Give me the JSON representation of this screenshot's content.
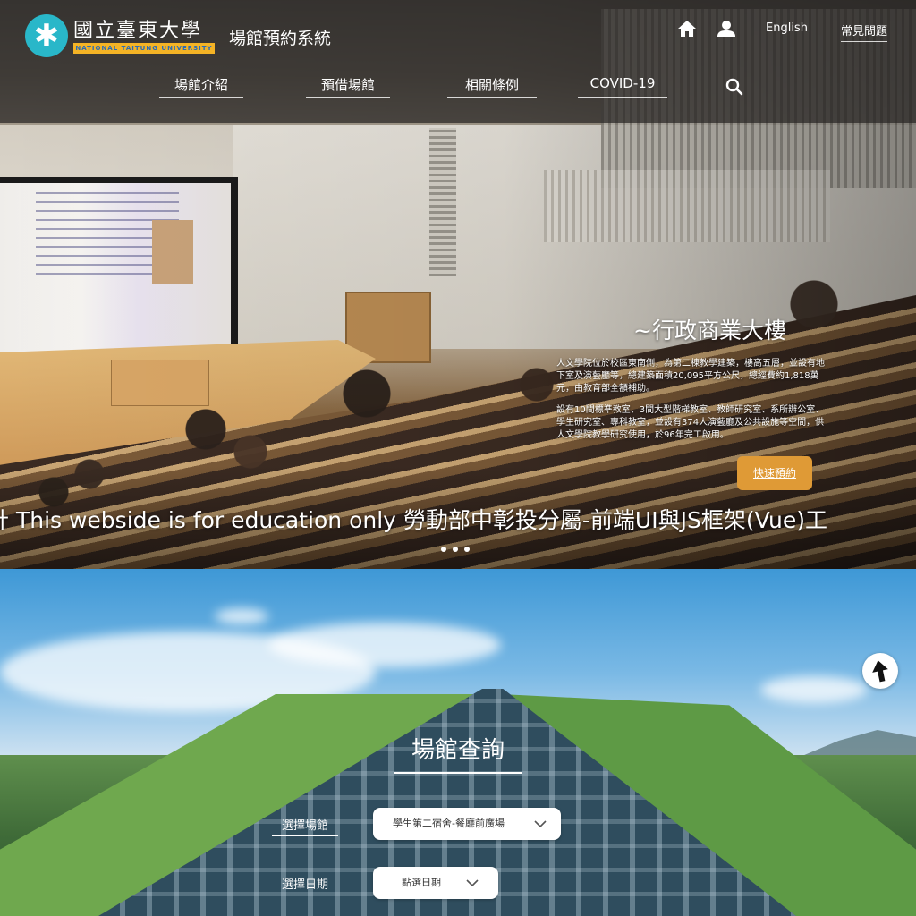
{
  "header": {
    "logo_cn": "國立臺東大學",
    "logo_en": "NATIONAL TAITUNG UNIVERSITY",
    "site_title": "場館預約系統",
    "home_icon": "home-icon",
    "user_icon": "user-icon",
    "lang_label": "English",
    "faq_label": "常見問題"
  },
  "nav": {
    "items": [
      {
        "label": "場館介紹"
      },
      {
        "label": "預借場館"
      },
      {
        "label": "相關條例"
      },
      {
        "label": "COVID-19"
      }
    ],
    "search_icon": "search-icon"
  },
  "slide": {
    "title": "~行政商業大樓",
    "text1": "人文學院位於校區東南側，為第二棟教學建築，樓高五層，並設有地下室及演藝廳等，總建築面積20,095平方公尺，總經費約1,818萬元，由教育部全額補助。",
    "text2": "設有10間標準教室、3間大型階梯教室、教師研究室、系所辦公室、學生研究室、專科教室，並設有374人演藝廳及公共設施等空間，供人文學院教學研究使用，於96年完工啟用。",
    "button_label": "快速預約",
    "marquee": "設計 This webside is for education only 勞動部中彰投分屬-前端UI與JS框架(Vue)工",
    "slide_count": 3,
    "active_slide": 1
  },
  "search_panel": {
    "title": "場館查詢",
    "venue_label": "選擇場館",
    "venue_value": "學生第二宿舍-餐廳前廣場",
    "date_label": "選擇日期",
    "date_value": "點選日期"
  },
  "back_to_top_icon": "arrow-up-icon",
  "colors": {
    "accent_orange": "#df9a36",
    "logo_teal": "#29b7c9",
    "logo_gold": "#f4b325"
  }
}
